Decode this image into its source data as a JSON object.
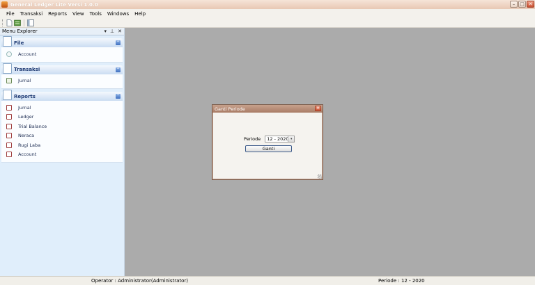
{
  "window": {
    "title": "General Ledger Lite Versi 1.0.0",
    "controls": {
      "minimize": "–",
      "maximize": "□",
      "close": "✕"
    }
  },
  "menubar": {
    "items": [
      "File",
      "Transaksi",
      "Reports",
      "View",
      "Tools",
      "Windows",
      "Help"
    ]
  },
  "toolbar": {
    "icons": [
      "new-document-icon",
      "tree-icon",
      "panel-toggle-icon"
    ]
  },
  "explorer": {
    "title": "Menu Explorer",
    "controls": {
      "dropdown": "▾",
      "pin": "⊥",
      "close": "✕"
    },
    "groups": [
      {
        "label": "File",
        "items": [
          "Account"
        ]
      },
      {
        "label": "Transaksi",
        "items": [
          "Jurnal"
        ]
      },
      {
        "label": "Reports",
        "items": [
          "Jurnal",
          "Ledger",
          "Trial Balance",
          "Neraca",
          "Rugi Laba",
          "Account"
        ]
      }
    ],
    "collapse_glyph": "⌃"
  },
  "dialog": {
    "title": "Ganti Periode",
    "close_glyph": "✕",
    "periode_label": "Periode",
    "periode_value": "12 - 2020",
    "select_arrow": "▾",
    "button_label": "Ganti"
  },
  "statusbar": {
    "operator": "Operator : Administrator(Administrator)",
    "periode": "Periode : 12 - 2020"
  },
  "colors": {
    "workspace": "#ababab",
    "titlebar": "#e8c8b4",
    "explorer_bg": "#e0eefb",
    "group_label": "#1e3a73"
  }
}
